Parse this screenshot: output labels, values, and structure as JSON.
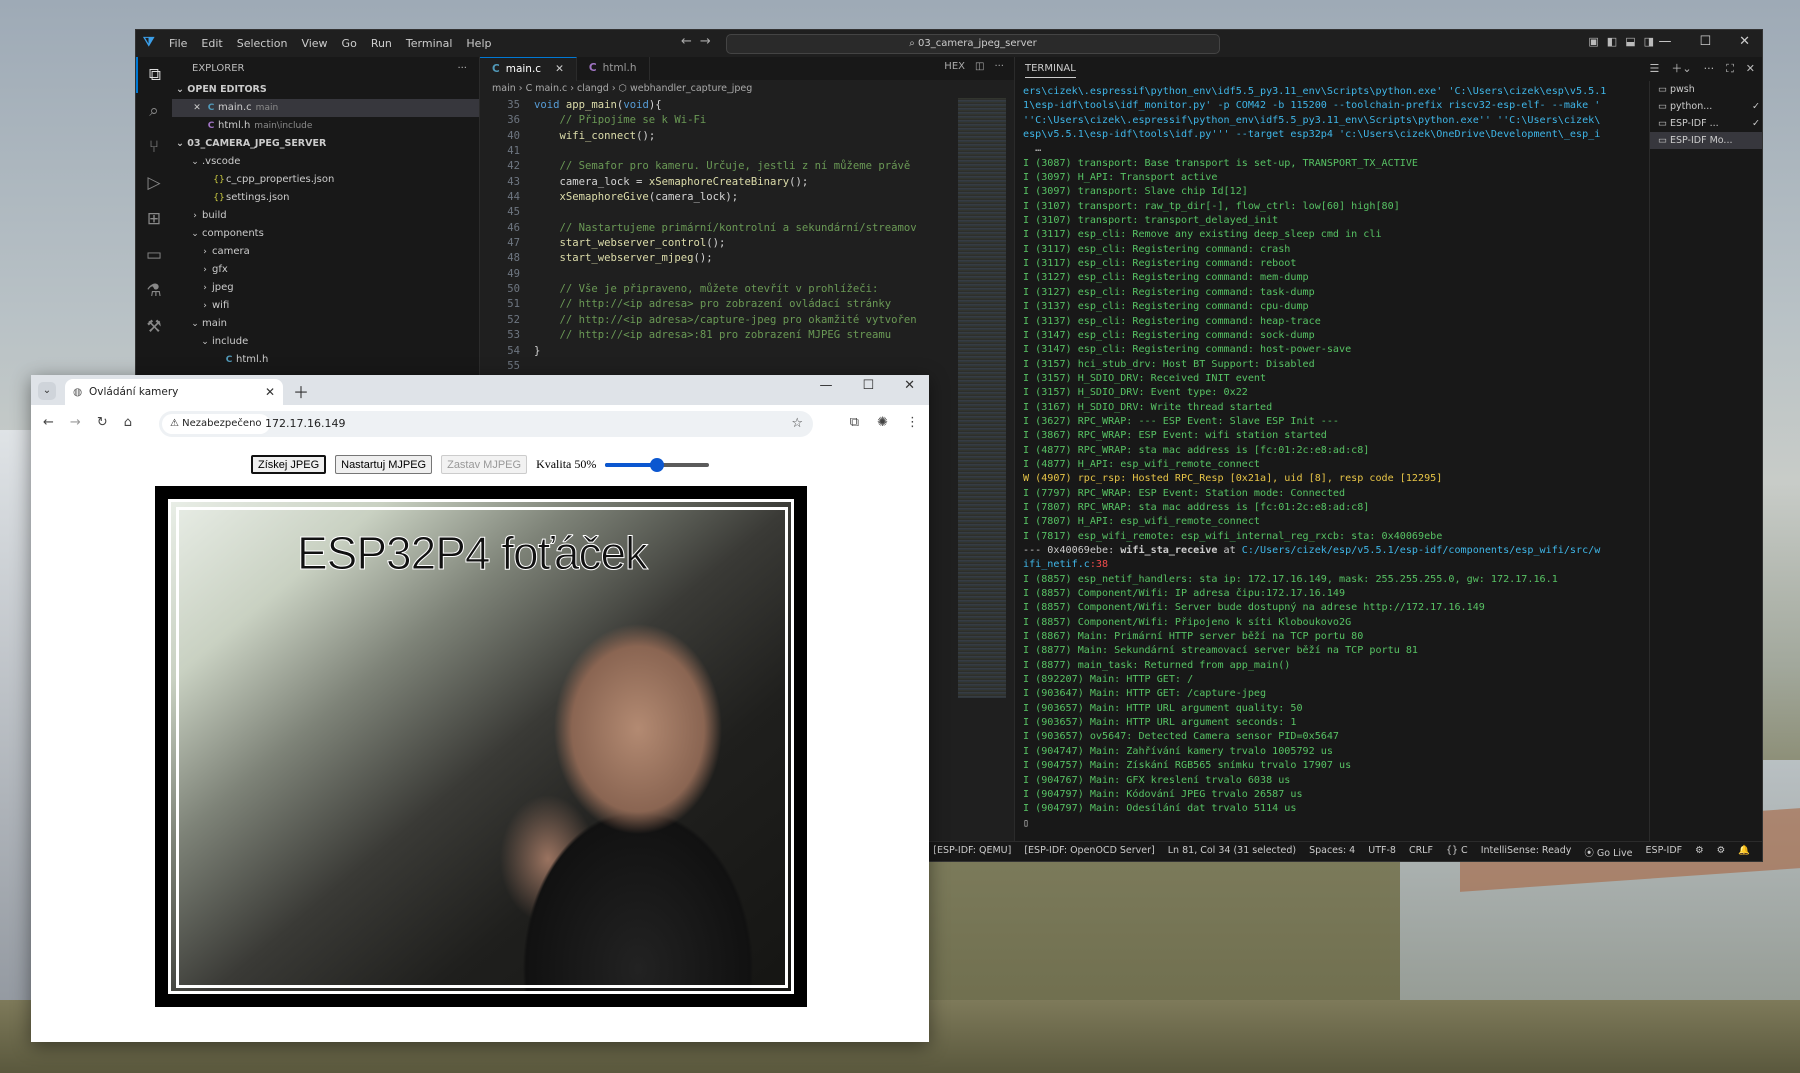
{
  "vscode": {
    "menu": [
      "File",
      "Edit",
      "Selection",
      "View",
      "Go",
      "Run",
      "Terminal",
      "Help"
    ],
    "search": "03_camera_jpeg_server",
    "explorer_title": "EXPLORER",
    "open_editors_label": "OPEN EDITORS",
    "open_editors": [
      {
        "name": "main.c",
        "desc": "main",
        "type": "c"
      },
      {
        "name": "html.h",
        "desc": "main\\include",
        "type": "h"
      }
    ],
    "project_label": "03_CAMERA_JPEG_SERVER",
    "tree": [
      {
        "name": ".vscode",
        "indent": 1,
        "arrow": "⌄",
        "type": "folder"
      },
      {
        "name": "c_cpp_properties.json",
        "indent": 2,
        "arrow": "",
        "type": "json"
      },
      {
        "name": "settings.json",
        "indent": 2,
        "arrow": "",
        "type": "json"
      },
      {
        "name": "build",
        "indent": 1,
        "arrow": "›",
        "type": "folder"
      },
      {
        "name": "components",
        "indent": 1,
        "arrow": "⌄",
        "type": "folder"
      },
      {
        "name": "camera",
        "indent": 2,
        "arrow": "›",
        "type": "folder"
      },
      {
        "name": "gfx",
        "indent": 2,
        "arrow": "›",
        "type": "folder"
      },
      {
        "name": "jpeg",
        "indent": 2,
        "arrow": "›",
        "type": "folder"
      },
      {
        "name": "wifi",
        "indent": 2,
        "arrow": "›",
        "type": "folder"
      },
      {
        "name": "main",
        "indent": 1,
        "arrow": "⌄",
        "type": "folder"
      },
      {
        "name": "include",
        "indent": 2,
        "arrow": "⌄",
        "type": "folder"
      },
      {
        "name": "html.h",
        "indent": 3,
        "arrow": "",
        "type": "c"
      }
    ],
    "tabs": [
      {
        "name": "main.c",
        "active": true,
        "type": "c"
      },
      {
        "name": "html.h",
        "active": false,
        "type": "h"
      }
    ],
    "breadcrumb": "main  ›  C  main.c  ›  clangd  ›  ⬡ webhandler_capture_jpeg",
    "hex_label": "HEX",
    "code": [
      {
        "n": "35",
        "t": [
          [
            "kw",
            "void "
          ],
          [
            "fn",
            "app_main"
          ],
          [
            "pl",
            "("
          ],
          [
            "kw",
            "void"
          ],
          [
            "pl",
            "){"
          ]
        ]
      },
      {
        "n": "36",
        "t": [
          [
            "cm",
            "    // Připojíme se k Wi-Fi"
          ]
        ]
      },
      {
        "n": "40",
        "t": [
          [
            "fn",
            "    wifi_connect"
          ],
          [
            "pl",
            "();"
          ]
        ]
      },
      {
        "n": "41",
        "t": []
      },
      {
        "n": "42",
        "t": [
          [
            "cm",
            "    // Semafor pro kameru. Určuje, jestli z ní můžeme právě"
          ]
        ]
      },
      {
        "n": "43",
        "t": [
          [
            "pl",
            "    camera_lock = "
          ],
          [
            "fn",
            "xSemaphoreCreateBinary"
          ],
          [
            "pl",
            "();"
          ]
        ]
      },
      {
        "n": "44",
        "t": [
          [
            "fn",
            "    xSemaphoreGive"
          ],
          [
            "pl",
            "(camera_lock);"
          ]
        ]
      },
      {
        "n": "45",
        "t": []
      },
      {
        "n": "46",
        "t": [
          [
            "cm",
            "    // Nastartujeme primární/kontrolní a sekundární/streamov"
          ]
        ]
      },
      {
        "n": "47",
        "t": [
          [
            "fn",
            "    start_webserver_control"
          ],
          [
            "pl",
            "();"
          ]
        ]
      },
      {
        "n": "48",
        "t": [
          [
            "fn",
            "    start_webserver_mjpeg"
          ],
          [
            "pl",
            "();"
          ]
        ]
      },
      {
        "n": "49",
        "t": []
      },
      {
        "n": "50",
        "t": [
          [
            "cm",
            "    // Vše je připraveno, můžete otevřít v prohlížeči:"
          ]
        ]
      },
      {
        "n": "51",
        "t": [
          [
            "cm",
            "    // http://<ip adresa> pro zobrazení ovládací stránky"
          ]
        ]
      },
      {
        "n": "52",
        "t": [
          [
            "cm",
            "    // http://<ip adresa>/capture-jpeg pro okamžité vytvořen"
          ]
        ]
      },
      {
        "n": "53",
        "t": [
          [
            "cm",
            "    // http://<ip adresa>:81 pro zobrazení MJPEG streamu"
          ]
        ]
      },
      {
        "n": "54",
        "t": [
          [
            "pl",
            "}"
          ]
        ]
      },
      {
        "n": "55",
        "t": []
      }
    ],
    "terminal_label": "TERMINAL",
    "terminal_lines": [
      {
        "c": "cmd",
        "t": "ers\\cizek\\.espressif\\python_env\\idf5.5_py3.11_env\\Scripts\\python.exe' 'C:\\Users\\cizek\\esp\\v5.5.1"
      },
      {
        "c": "cmd",
        "t": "1\\esp-idf\\tools\\idf_monitor.py' -p COM42 -b 115200 --toolchain-prefix riscv32-esp-elf- --make '"
      },
      {
        "c": "cmd",
        "t": "''C:\\Users\\cizek\\.espressif\\python_env\\idf5.5_py3.11_env\\Scripts\\python.exe'' ''C:\\Users\\cizek\\"
      },
      {
        "c": "cmd",
        "t": "esp\\v5.5.1\\esp-idf\\tools\\idf.py''' --target esp32p4 'c:\\Users\\cizek\\OneDrive\\Development\\_esp_i"
      },
      {
        "c": "plain",
        "t": "  …"
      },
      {
        "c": "ok",
        "t": "I (3087) transport: Base transport is set-up, TRANSPORT_TX_ACTIVE"
      },
      {
        "c": "ok",
        "t": "I (3097) H_API: Transport active"
      },
      {
        "c": "ok",
        "t": "I (3097) transport: Slave chip Id[12]"
      },
      {
        "c": "ok",
        "t": "I (3107) transport: raw_tp_dir[-], flow_ctrl: low[60] high[80]"
      },
      {
        "c": "ok",
        "t": "I (3107) transport: transport_delayed_init"
      },
      {
        "c": "ok",
        "t": "I (3117) esp_cli: Remove any existing deep_sleep cmd in cli"
      },
      {
        "c": "ok",
        "t": "I (3117) esp_cli: Registering command: crash"
      },
      {
        "c": "ok",
        "t": "I (3117) esp_cli: Registering command: reboot"
      },
      {
        "c": "ok",
        "t": "I (3127) esp_cli: Registering command: mem-dump"
      },
      {
        "c": "ok",
        "t": "I (3127) esp_cli: Registering command: task-dump"
      },
      {
        "c": "ok",
        "t": "I (3137) esp_cli: Registering command: cpu-dump"
      },
      {
        "c": "ok",
        "t": "I (3137) esp_cli: Registering command: heap-trace"
      },
      {
        "c": "ok",
        "t": "I (3147) esp_cli: Registering command: sock-dump"
      },
      {
        "c": "ok",
        "t": "I (3147) esp_cli: Registering command: host-power-save"
      },
      {
        "c": "ok",
        "t": "I (3157) hci_stub_drv: Host BT Support: Disabled"
      },
      {
        "c": "ok",
        "t": "I (3157) H_SDIO_DRV: Received INIT event"
      },
      {
        "c": "ok",
        "t": "I (3157) H_SDIO_DRV: Event type: 0x22"
      },
      {
        "c": "ok",
        "t": "I (3167) H_SDIO_DRV: Write thread started"
      },
      {
        "c": "ok",
        "t": "I (3627) RPC_WRAP: --- ESP Event: Slave ESP Init ---"
      },
      {
        "c": "ok",
        "t": "I (3867) RPC_WRAP: ESP Event: wifi station started"
      },
      {
        "c": "ok",
        "t": "I (4877) RPC_WRAP: sta mac address is [fc:01:2c:e8:ad:c8]"
      },
      {
        "c": "ok",
        "t": "I (4877) H_API: esp_wifi_remote_connect"
      },
      {
        "c": "warn",
        "t": "W (4907) rpc_rsp: Hosted RPC_Resp [0x21a], uid [8], resp code [12295]"
      },
      {
        "c": "ok",
        "t": "I (7797) RPC_WRAP: ESP Event: Station mode: Connected"
      },
      {
        "c": "ok",
        "t": "I (7807) RPC_WRAP: sta mac address is [fc:01:2c:e8:ad:c8]"
      },
      {
        "c": "ok",
        "t": "I (7807) H_API: esp_wifi_remote_connect"
      },
      {
        "c": "ok",
        "t": "I (7817) esp_wifi_remote: esp_wifi_internal_reg_rxcb: sta: 0x40069ebe"
      },
      {
        "c": "trace",
        "pre": "--- 0x40069ebe: ",
        "bold": "wifi_sta_receive",
        "mid": " at ",
        "path": "C:/Users/cizek/esp/v5.5.1/esp-idf/components/esp_wifi/src/w"
      },
      {
        "c": "trace2",
        "path": "ifi_netif.c",
        "err": ":38"
      },
      {
        "c": "ok",
        "t": "I (8857) esp_netif_handlers: sta ip: 172.17.16.149, mask: 255.255.255.0, gw: 172.17.16.1"
      },
      {
        "c": "ok",
        "t": "I (8857) Component/Wifi: IP adresa čipu:172.17.16.149"
      },
      {
        "c": "ok",
        "t": "I (8857) Component/Wifi: Server bude dostupný na adrese http://172.17.16.149"
      },
      {
        "c": "ok",
        "t": "I (8857) Component/Wifi: Připojeno k síti Kloboukovo2G"
      },
      {
        "c": "ok",
        "t": "I (8867) Main: Primární HTTP server běží na TCP portu 80"
      },
      {
        "c": "ok",
        "t": "I (8877) Main: Sekundární streamovací server běží na TCP portu 81"
      },
      {
        "c": "ok",
        "t": "I (8877) main_task: Returned from app_main()"
      },
      {
        "c": "ok",
        "t": "I (892207) Main: HTTP GET: /"
      },
      {
        "c": "ok",
        "t": "I (903647) Main: HTTP GET: /capture-jpeg"
      },
      {
        "c": "ok",
        "t": "I (903657) Main: HTTP URL argument quality: 50"
      },
      {
        "c": "ok",
        "t": "I (903657) Main: HTTP URL argument seconds: 1"
      },
      {
        "c": "ok",
        "t": "I (903657) ov5647: Detected Camera sensor PID=0x5647"
      },
      {
        "c": "ok",
        "t": "I (904747) Main: Zahřívání kamery trvalo 1005792 us"
      },
      {
        "c": "ok",
        "t": "I (904757) Main: Získání RGB565 snímku trvalo 17907 us"
      },
      {
        "c": "ok",
        "t": "I (904767) Main: GFX kreslení trvalo 6038 us"
      },
      {
        "c": "ok",
        "t": "I (904797) Main: Kódování JPEG trvalo 26587 us"
      },
      {
        "c": "ok",
        "t": "I (904797) Main: Odesílání dat trvalo 5114 us"
      },
      {
        "c": "plain",
        "t": "▯"
      }
    ],
    "terminal_list": [
      {
        "name": "pwsh",
        "check": false,
        "sel": false
      },
      {
        "name": "python...",
        "check": true,
        "sel": false
      },
      {
        "name": "ESP-IDF ...",
        "check": true,
        "sel": false
      },
      {
        "name": "ESP-IDF Mo...",
        "check": false,
        "sel": true
      }
    ],
    "status": [
      "[ESP-IDF: QEMU]",
      "[ESP-IDF: OpenOCD Server]",
      "Ln 81, Col 34 (31 selected)",
      "Spaces: 4",
      "UTF-8",
      "CRLF",
      "{} C",
      "IntelliSense: Ready",
      "⦿ Go Live",
      "ESP-IDF",
      "⚙",
      "⚙",
      "🔔"
    ]
  },
  "browser": {
    "tab_title": "Ovládání kamery",
    "security_chip": "Nezabezpečeno",
    "url": "172.17.16.149",
    "btn_get_jpeg": "Získej JPEG",
    "btn_start_mjpeg": "Nastartuj MJPEG",
    "btn_stop_mjpeg": "Zastav MJPEG",
    "quality_label": "Kvalita 50%",
    "quality_value": 50,
    "caption": "ESP32P4 foťáček"
  }
}
